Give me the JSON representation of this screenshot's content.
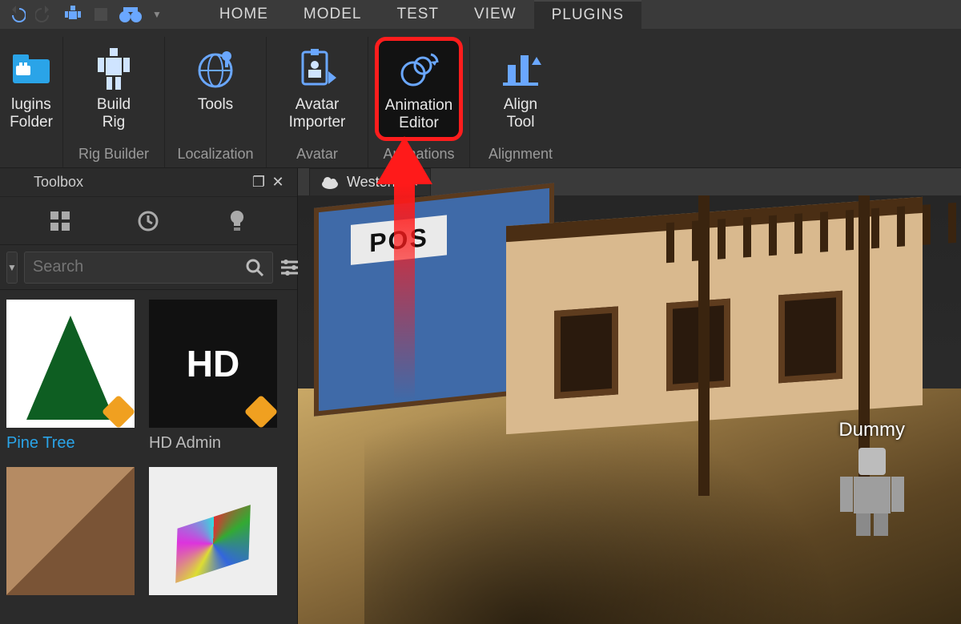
{
  "menu": {
    "tabs": [
      "HOME",
      "MODEL",
      "TEST",
      "VIEW",
      "PLUGINS"
    ],
    "active": 4
  },
  "ribbon_groups": [
    {
      "caption": "",
      "buttons": [
        {
          "key": "plugins-folder",
          "label": "lugins\nFolder",
          "icon": "folder"
        }
      ]
    },
    {
      "caption": "Rig Builder",
      "buttons": [
        {
          "key": "build-rig",
          "label": "Build\nRig",
          "icon": "rig"
        }
      ]
    },
    {
      "caption": "Localization",
      "buttons": [
        {
          "key": "tools",
          "label": "Tools",
          "icon": "globe"
        }
      ]
    },
    {
      "caption": "Avatar",
      "buttons": [
        {
          "key": "avatar-importer",
          "label": "Avatar\nImporter",
          "icon": "avatar"
        }
      ]
    },
    {
      "caption": "Animations",
      "buttons": [
        {
          "key": "animation-editor",
          "label": "Animation\nEditor",
          "icon": "anim",
          "highlight": true
        }
      ]
    },
    {
      "caption": "Alignment",
      "buttons": [
        {
          "key": "align-tool",
          "label": "Align\nTool",
          "icon": "align"
        }
      ]
    }
  ],
  "toolbox": {
    "title": "Toolbox",
    "search_placeholder": "Search",
    "assets": [
      {
        "name": "Pine Tree",
        "selected": true,
        "thumb": "tree"
      },
      {
        "name": "HD Admin",
        "selected": false,
        "thumb": "hd"
      },
      {
        "name": "",
        "selected": false,
        "thumb": "room"
      },
      {
        "name": "",
        "selected": false,
        "thumb": "tiles"
      }
    ]
  },
  "document": {
    "name": "Western"
  },
  "scene": {
    "building_sign": "POS",
    "character_label": "Dummy"
  }
}
